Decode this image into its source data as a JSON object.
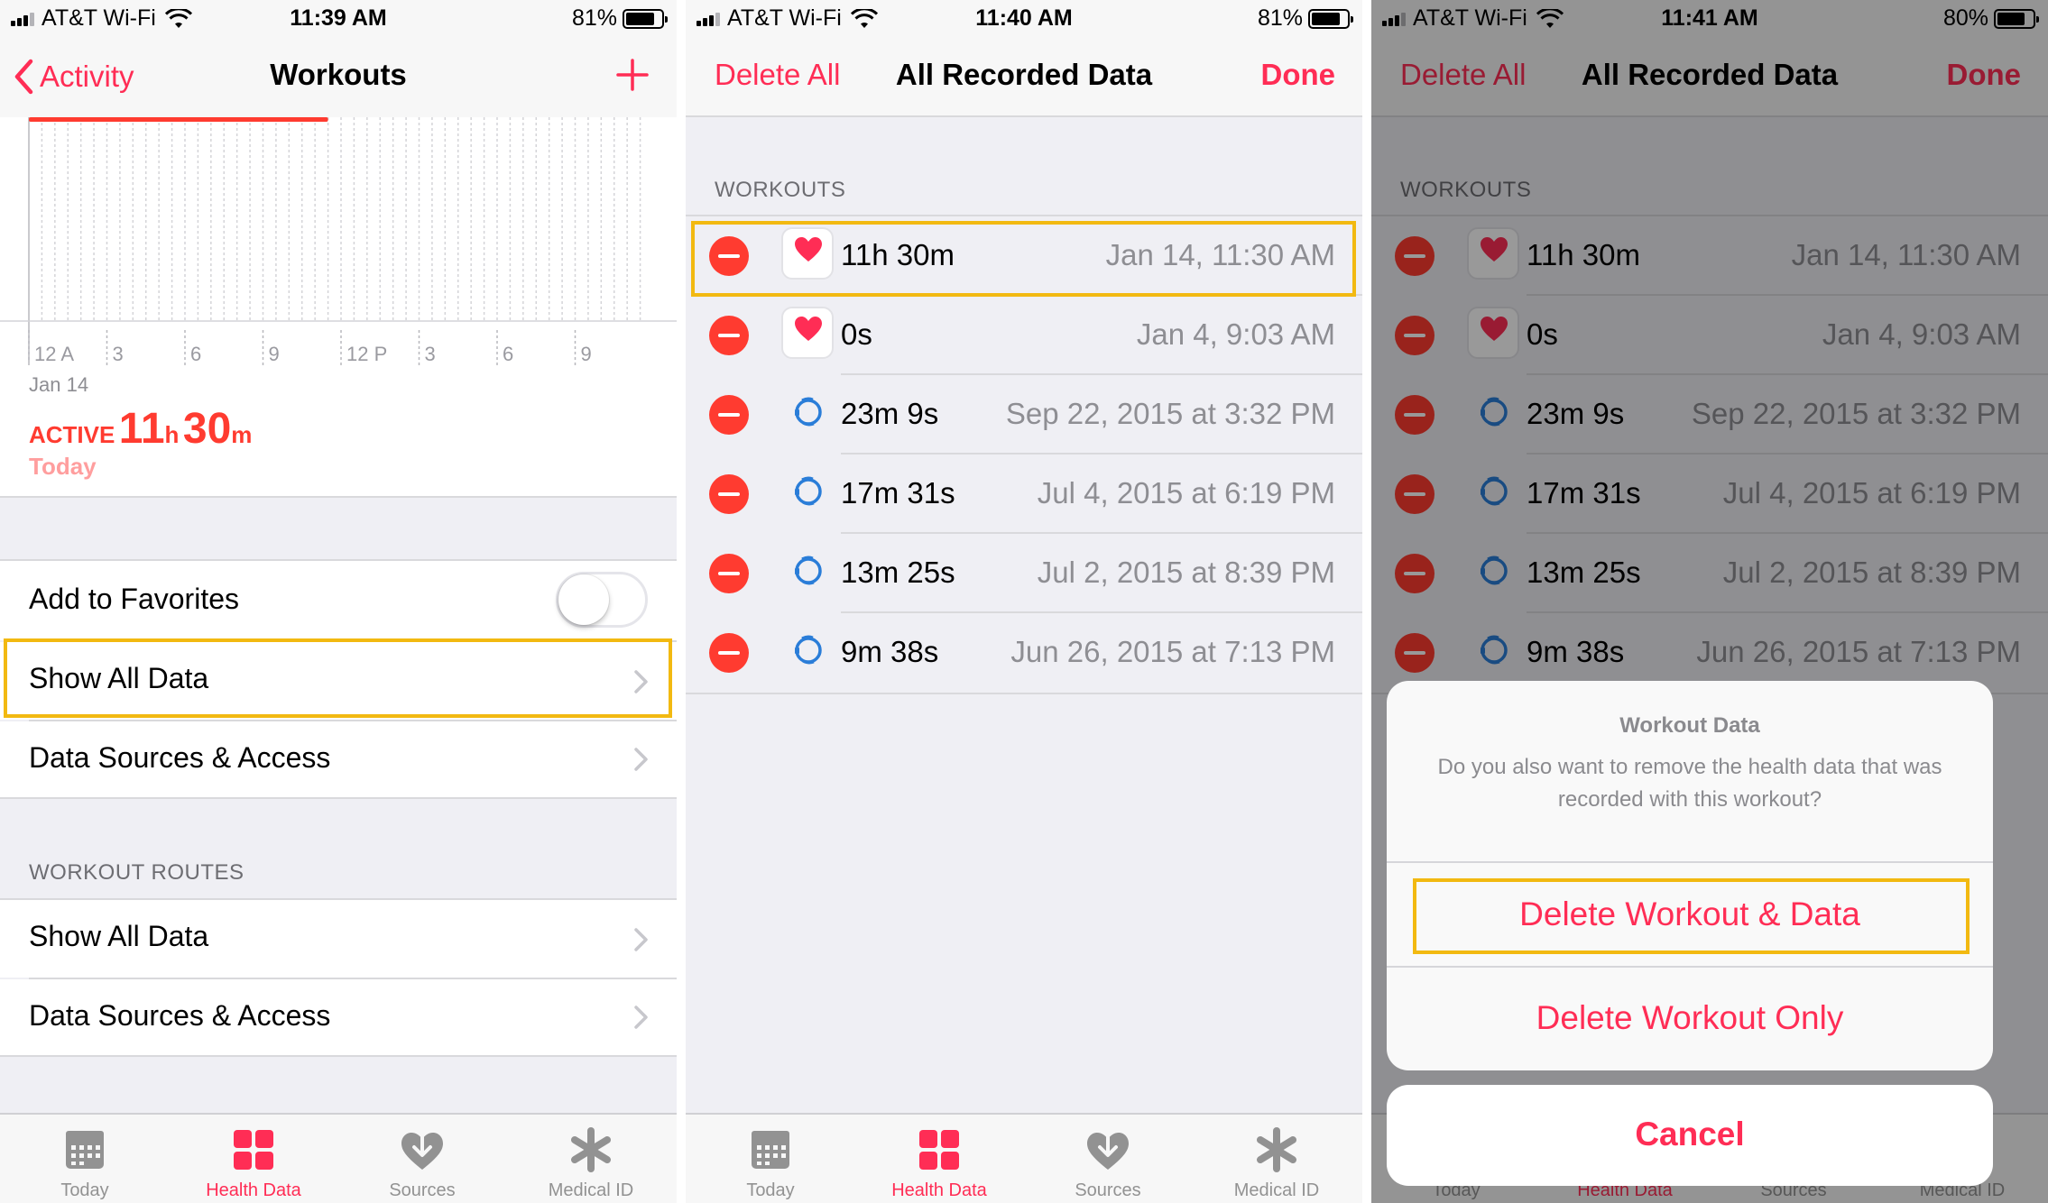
{
  "colors": {
    "accent": "#ff2d55",
    "delete": "#ff3b30",
    "highlight": "#f2b911",
    "watch_icon": "#2a7dd8"
  },
  "screens": [
    {
      "status": {
        "carrier": "AT&T Wi-Fi",
        "time": "11:39 AM",
        "battery": "81%",
        "battery_level": 0.81
      },
      "nav": {
        "back_label": "Activity",
        "title": "Workouts",
        "add_icon": "plus-icon"
      },
      "chart": {
        "type": "bar",
        "x_ticks": [
          "12 A",
          "3",
          "6",
          "9",
          "12 P",
          "3",
          "6",
          "9"
        ],
        "date_label": "Jan 14",
        "series": [
          {
            "values": [
              1.0
            ]
          }
        ],
        "summary_prefix": "ACTIVE",
        "summary_hours": "11",
        "summary_h_unit": "h",
        "summary_minutes": "30",
        "summary_m_unit": "m",
        "summary_day": "Today"
      },
      "cells": {
        "favorites": "Add to Favorites",
        "favorites_on": false,
        "show_all": "Show All Data",
        "sources": "Data Sources & Access"
      },
      "routes": {
        "header": "WORKOUT ROUTES",
        "show_all": "Show All Data",
        "sources": "Data Sources & Access"
      }
    },
    {
      "status": {
        "carrier": "AT&T Wi-Fi",
        "time": "11:40 AM",
        "battery": "81%",
        "battery_level": 0.81
      },
      "nav": {
        "left": "Delete All",
        "title": "All Recorded Data",
        "right": "Done"
      },
      "section_header": "WORKOUTS",
      "rows": [
        {
          "duration": "11h 30m",
          "date": "Jan 14, 11:30 AM",
          "icon": "heart-icon"
        },
        {
          "duration": "0s",
          "date": "Jan 4, 9:03 AM",
          "icon": "heart-icon"
        },
        {
          "duration": "23m 9s",
          "date": "Sep 22, 2015 at 3:32 PM",
          "icon": "watch-icon"
        },
        {
          "duration": "17m 31s",
          "date": "Jul 4, 2015 at 6:19 PM",
          "icon": "watch-icon"
        },
        {
          "duration": "13m 25s",
          "date": "Jul 2, 2015 at 8:39 PM",
          "icon": "watch-icon"
        },
        {
          "duration": "9m 38s",
          "date": "Jun 26, 2015 at 7:13 PM",
          "icon": "watch-icon"
        }
      ]
    },
    {
      "status": {
        "carrier": "AT&T Wi-Fi",
        "time": "11:41 AM",
        "battery": "80%",
        "battery_level": 0.8
      },
      "nav": {
        "left": "Delete All",
        "title": "All Recorded Data",
        "right": "Done"
      },
      "section_header": "WORKOUTS",
      "rows": [
        {
          "duration": "11h 30m",
          "date": "Jan 14, 11:30 AM",
          "icon": "heart-icon"
        },
        {
          "duration": "0s",
          "date": "Jan 4, 9:03 AM",
          "icon": "heart-icon"
        },
        {
          "duration": "23m 9s",
          "date": "Sep 22, 2015 at 3:32 PM",
          "icon": "watch-icon"
        },
        {
          "duration": "17m 31s",
          "date": "Jul 4, 2015 at 6:19 PM",
          "icon": "watch-icon"
        },
        {
          "duration": "13m 25s",
          "date": "Jul 2, 2015 at 8:39 PM",
          "icon": "watch-icon"
        },
        {
          "duration": "9m 38s",
          "date": "Jun 26, 2015 at 7:13 PM",
          "icon": "watch-icon"
        }
      ],
      "sheet": {
        "title": "Workout Data",
        "message": "Do you also want to remove the health data that was recorded with this workout?",
        "primary": "Delete Workout & Data",
        "secondary": "Delete Workout Only",
        "cancel": "Cancel"
      }
    }
  ],
  "tabbar": [
    {
      "label": "Today",
      "icon": "calendar-icon",
      "active": false
    },
    {
      "label": "Health Data",
      "icon": "grid-icon",
      "active": true
    },
    {
      "label": "Sources",
      "icon": "heart-download-icon",
      "active": false
    },
    {
      "label": "Medical ID",
      "icon": "asterisk-icon",
      "active": false
    }
  ]
}
